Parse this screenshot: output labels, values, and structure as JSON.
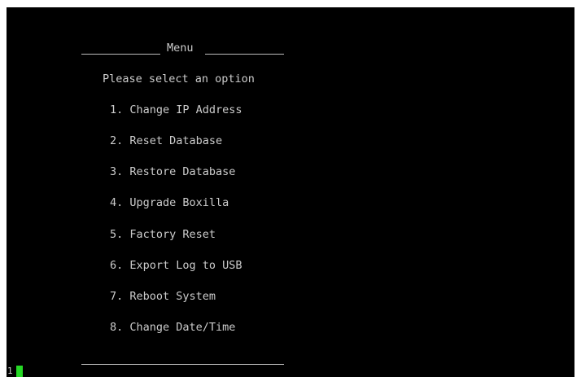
{
  "menu": {
    "title": "Menu",
    "prompt": "Please select an option",
    "items": [
      "1. Change IP Address",
      "2. Reset Database",
      "3. Restore Database",
      "4. Upgrade Boxilla",
      "5. Factory Reset",
      "6. Export Log to USB",
      "7. Reboot System",
      "8. Change Date/Time"
    ]
  },
  "input": {
    "typed": "1"
  },
  "colors": {
    "background": "#000000",
    "text": "#cccccc",
    "cursor": "#26d926"
  }
}
